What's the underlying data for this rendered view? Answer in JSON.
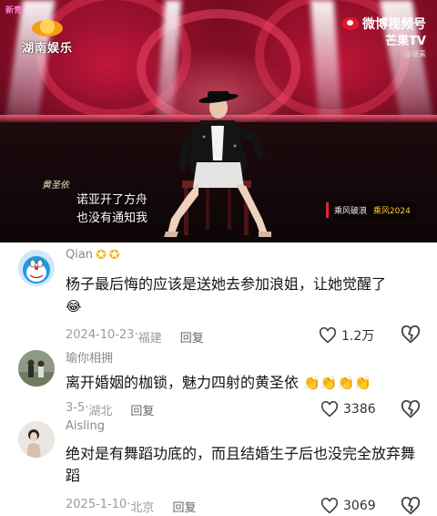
{
  "video": {
    "corner_tag": "新青",
    "channel_logo_text": "湖南娱乐",
    "watermark_platform": "微博视频号",
    "watermark_channel": "芒果TV",
    "watermark_handle": "@瑞素",
    "performer_name": "黄圣依",
    "subtitle_line1": "诺亚开了方舟",
    "subtitle_line2": "也没有通知我",
    "show_tag": "乘风破浪",
    "show_tag_sub": "乘风2024",
    "colors": {
      "stage_red": "#c4163c",
      "beam": "#ffffff"
    }
  },
  "comments": [
    {
      "username": "Qian",
      "badges": [
        "crown-icon",
        "crown-icon"
      ],
      "badge_glyph": "✪",
      "avatar_icon": "doraemon-avatar-icon",
      "text": "杨子最后悔的应该是送她去参加浪姐，让她觉醒了",
      "trailing_emoji": "😂",
      "date": "2024-10-23",
      "location": "福建",
      "reply_label": "回复",
      "likes": "1.2万"
    },
    {
      "username": "瑜你相拥",
      "avatar_icon": "photo-avatar-icon",
      "text": "离开婚姻的枷锁，魅力四射的黄圣依",
      "trailing_emoji": "👏👏👏👏",
      "date": "3-5",
      "location": "湖北",
      "reply_label": "回复",
      "likes": "3386"
    },
    {
      "username": "Aisling",
      "avatar_icon": "photo-avatar-icon",
      "text": "绝对是有舞蹈功底的，而且结婚生子后也没完全放弃舞蹈",
      "date": "2025-1-10",
      "location": "北京",
      "reply_label": "回复",
      "likes": "3069"
    }
  ],
  "separator": " · "
}
